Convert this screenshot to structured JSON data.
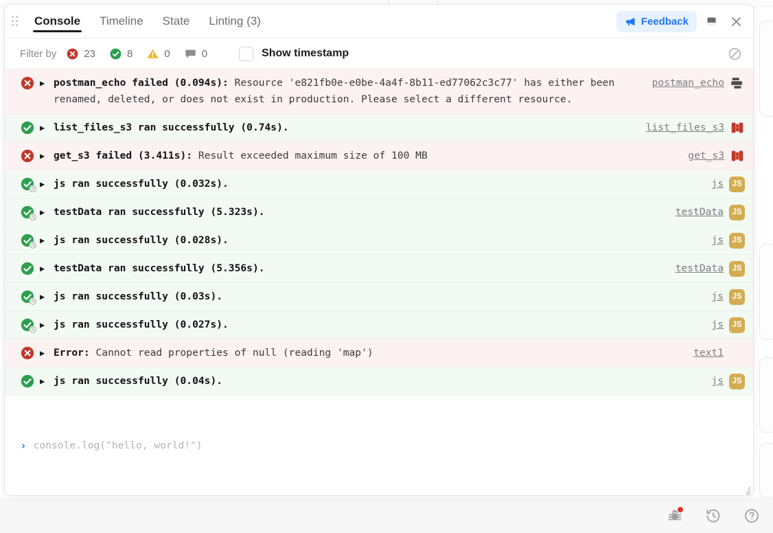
{
  "panel": {
    "drag_handle": "drag-handle",
    "tabs": [
      {
        "label": "Console",
        "active": true
      },
      {
        "label": "Timeline",
        "active": false
      },
      {
        "label": "State",
        "active": false
      },
      {
        "label": "Linting (3)",
        "active": false
      }
    ],
    "feedback_label": "Feedback",
    "feedback_icon": "megaphone-icon",
    "dock_icon": "dock-panel-icon",
    "close_icon": "close-icon"
  },
  "filter_bar": {
    "label": "Filter by",
    "counts": [
      {
        "icon": "error-icon",
        "value": "23"
      },
      {
        "icon": "success-icon",
        "value": "8"
      },
      {
        "icon": "warning-icon",
        "value": "0"
      },
      {
        "icon": "comment-icon",
        "value": "0"
      }
    ],
    "show_timestamp_label": "Show timestamp",
    "show_timestamp_checked": false,
    "clear_icon": "clear-console-icon"
  },
  "logs": [
    {
      "status": "error",
      "cached": false,
      "bold": "postman_echo failed (0.094s):",
      "rest": " Resource 'e821fb0e-e0be-4a4f-8b11-ed77062c3c77' has either been renamed, deleted, or does not exist in production. Please select a different resource.",
      "source": "postman_echo",
      "badge": "layers-icon"
    },
    {
      "status": "success",
      "cached": false,
      "bold": "list_files_s3 ran successfully (0.74s).",
      "rest": "",
      "source": "list_files_s3",
      "badge": "s3-bucket-icon"
    },
    {
      "status": "error",
      "cached": false,
      "bold": "get_s3 failed (3.411s):",
      "rest": " Result exceeded maximum size of 100 MB",
      "source": "get_s3",
      "badge": "s3-bucket-icon"
    },
    {
      "status": "success",
      "cached": true,
      "bold": "js ran successfully (0.032s).",
      "rest": "",
      "source": "js",
      "badge": "js-icon"
    },
    {
      "status": "success",
      "cached": true,
      "bold": "testData ran successfully (5.323s).",
      "rest": "",
      "source": "testData",
      "badge": "js-icon"
    },
    {
      "status": "success",
      "cached": true,
      "bold": "js ran successfully (0.028s).",
      "rest": "",
      "source": "js",
      "badge": "js-icon"
    },
    {
      "status": "success",
      "cached": false,
      "bold": "testData ran successfully (5.356s).",
      "rest": "",
      "source": "testData",
      "badge": "js-icon"
    },
    {
      "status": "success",
      "cached": true,
      "bold": "js ran successfully (0.03s).",
      "rest": "",
      "source": "js",
      "badge": "js-icon"
    },
    {
      "status": "success",
      "cached": true,
      "bold": "js ran successfully (0.027s).",
      "rest": "",
      "source": "js",
      "badge": "js-icon"
    },
    {
      "status": "error",
      "cached": false,
      "bold": "Error:",
      "rest": " Cannot read properties of null (reading 'map')",
      "source": "text1",
      "badge": "none"
    },
    {
      "status": "success",
      "cached": false,
      "bold": "js ran successfully (0.04s).",
      "rest": "",
      "source": "js",
      "badge": "js-icon"
    }
  ],
  "console_input": {
    "prompt": "›",
    "value": "",
    "placeholder": "console.log(\"hello, world!\")"
  },
  "bottom_toolbar": [
    {
      "icon": "bug-icon",
      "has_badge": true
    },
    {
      "icon": "history-icon",
      "has_badge": false
    },
    {
      "icon": "help-icon",
      "has_badge": false
    }
  ],
  "colors": {
    "error": "#c0392b",
    "success": "#2e9e4f",
    "warning": "#e8b931",
    "accent": "#2176f3",
    "js_badge": "#d3ad50",
    "row_ok_bg": "#f3faf4",
    "row_err_bg": "#fdf2f2"
  }
}
